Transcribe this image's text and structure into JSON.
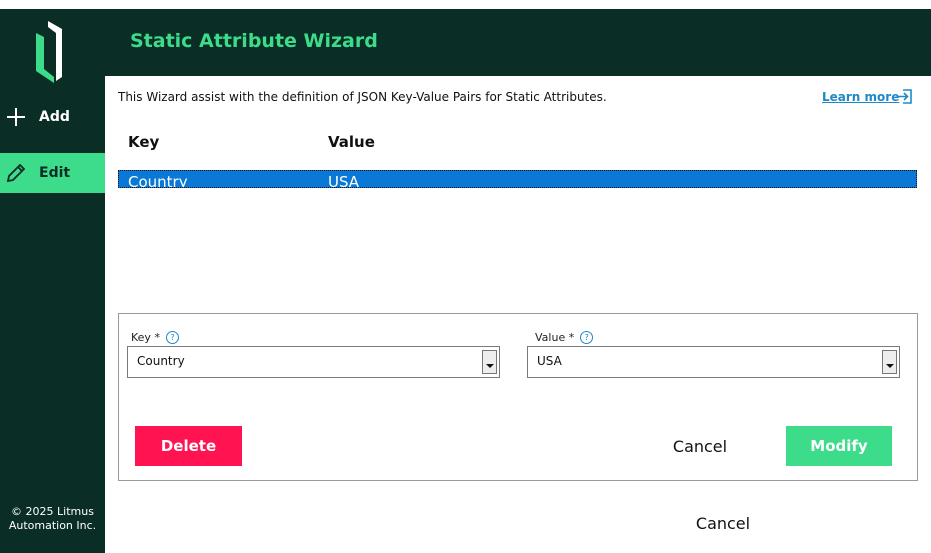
{
  "app": {
    "title": "Static Attribute Wizard",
    "copyright_line1": "© 2025 Litmus",
    "copyright_line2": "Automation Inc."
  },
  "sidebar": {
    "items": [
      {
        "label": "Add",
        "icon": "plus-icon"
      },
      {
        "label": "Edit",
        "icon": "pencil-icon",
        "active": true
      }
    ]
  },
  "intro": {
    "text": "This Wizard assist with the definition of JSON Key-Value Pairs for Static Attributes.",
    "learn_more": "Learn more",
    "learn_icon": "external-link-icon"
  },
  "table": {
    "headers": [
      "Key",
      "Value"
    ],
    "rows": [
      {
        "key": "Country",
        "value": "USA",
        "selected": true
      }
    ]
  },
  "editor": {
    "key_label": "Key *",
    "key_value": "Country",
    "value_label": "Value *",
    "value_value": "USA",
    "delete_label": "Delete",
    "cancel_label": "Cancel",
    "modify_label": "Modify"
  },
  "footer": {
    "cancel_label": "Cancel"
  },
  "colors": {
    "brand_dark": "#0a2d26",
    "accent_green": "#3ddc8a",
    "delete_red": "#ff1451",
    "selection_blue": "#0a78d6",
    "link_blue": "#1e88c8"
  }
}
